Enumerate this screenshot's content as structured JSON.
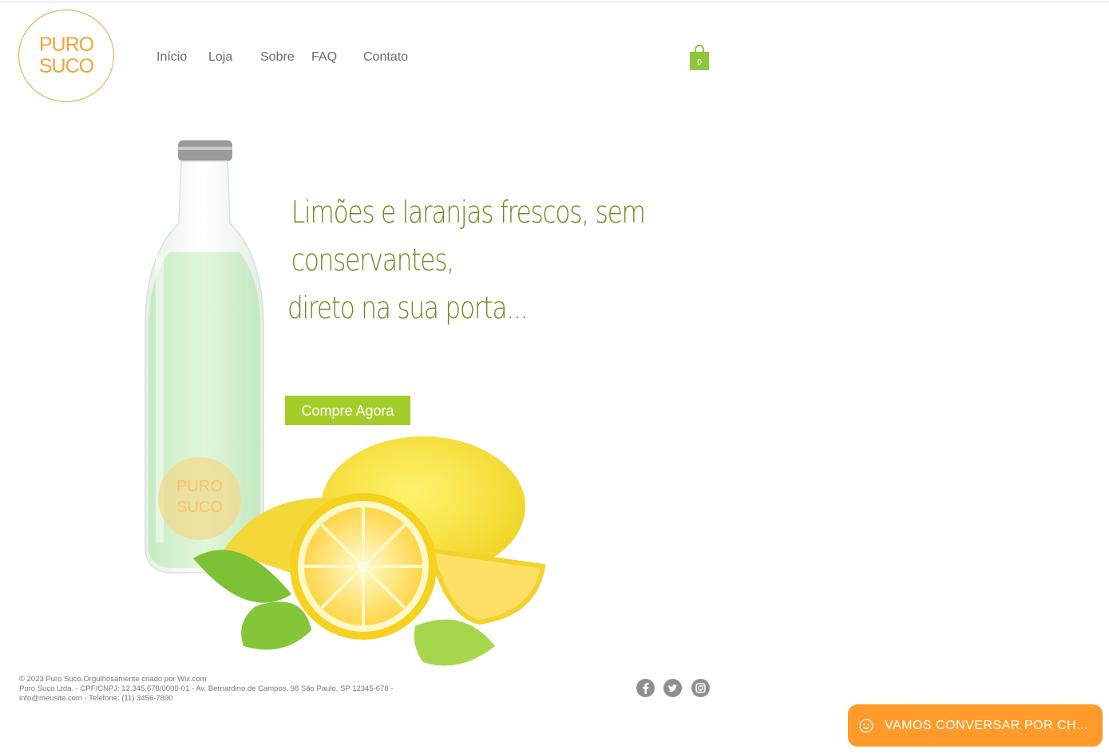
{
  "header": {
    "logo_line1": "PURO",
    "logo_line2": "SUCO",
    "nav": [
      {
        "label": "Início"
      },
      {
        "label": "Loja"
      },
      {
        "label": "Sobre"
      },
      {
        "label": "FAQ"
      },
      {
        "label": "Contato"
      }
    ],
    "cart_count": "0"
  },
  "hero": {
    "headline_line1": "Limões e laranjas frescos, sem",
    "headline_line2": "conservantes,",
    "headline_line3": "direto na sua porta...",
    "cta_label": "Compre Agora",
    "bottle_logo_line1": "PURO",
    "bottle_logo_line2": "SUCO"
  },
  "footer": {
    "line1": "© 2023 Puro Suco.Orgulhosamente criado por Wix.com",
    "line2": "Puro Suco Ltda. - CPF/CNPJ: 12.345.678/0000-01 - Av. Bernardino de Campos, 98 São Paulo, SP 12345-678 -",
    "line3": "info@meusite.com - Telefone: (11) 3456-7890",
    "social": [
      "facebook-icon",
      "twitter-icon",
      "instagram-icon"
    ]
  },
  "chat": {
    "label": "VAMOS CONVERSAR POR CH..."
  },
  "colors": {
    "brand_orange": "#f0a43a",
    "headline_green": "#6b8a1c",
    "cta_green": "#a4cd2a",
    "cart_green": "#8dc63f",
    "chat_orange": "#ff9b2b"
  }
}
